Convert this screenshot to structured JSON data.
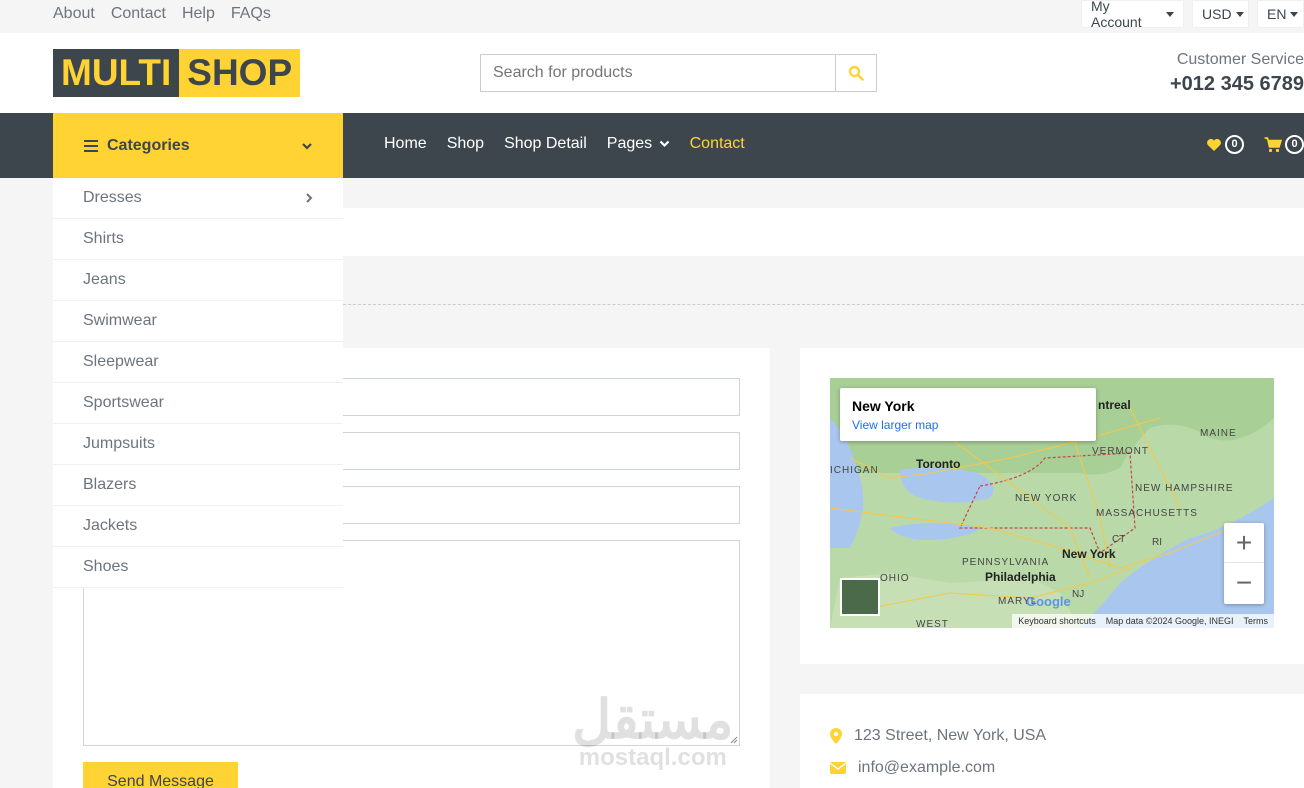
{
  "topbar": {
    "links": [
      "About",
      "Contact",
      "Help",
      "FAQs"
    ],
    "account": "My Account",
    "currency": "USD",
    "language": "EN"
  },
  "header": {
    "logo_part1": "MULTI",
    "logo_part2": "SHOP",
    "search_placeholder": "Search for products",
    "customer_service_label": "Customer Service",
    "phone": "+012 345 6789"
  },
  "nav": {
    "categories_label": "Categories",
    "links": [
      "Home",
      "Shop",
      "Shop Detail",
      "Pages",
      "Contact"
    ],
    "wishlist_count": "0",
    "cart_count": "0"
  },
  "categories": [
    "Dresses",
    "Shirts",
    "Jeans",
    "Swimwear",
    "Sleepwear",
    "Sportswear",
    "Jumpsuits",
    "Blazers",
    "Jackets",
    "Shoes"
  ],
  "form": {
    "send_label": "Send Message"
  },
  "map": {
    "card_title": "New York",
    "card_link": "View larger map",
    "labels": [
      "Toronto",
      "NEW YORK",
      "New York",
      "Philadelphia",
      "PENNSYLVANIA",
      "MASSACHUSETTS",
      "VERMONT",
      "MAINE",
      "NEW HAMPSHIRE",
      "OHIO",
      "ICHIGAN",
      "ntreal",
      "CT",
      "RI",
      "NJ",
      "MARYL",
      "WEST"
    ],
    "zoom_in": "+",
    "zoom_out": "−",
    "attribution": [
      "Keyboard shortcuts",
      "Map data ©2024 Google, INEGI",
      "Terms"
    ],
    "google": "Google"
  },
  "contact_info": {
    "address": "123 Street, New York, USA",
    "email": "info@example.com"
  },
  "watermark": {
    "arabic": "مستقل",
    "latin": "mostaql.com"
  },
  "colors": {
    "primary": "#ffd333",
    "dark": "#3d464d",
    "light": "#f5f5f5"
  }
}
